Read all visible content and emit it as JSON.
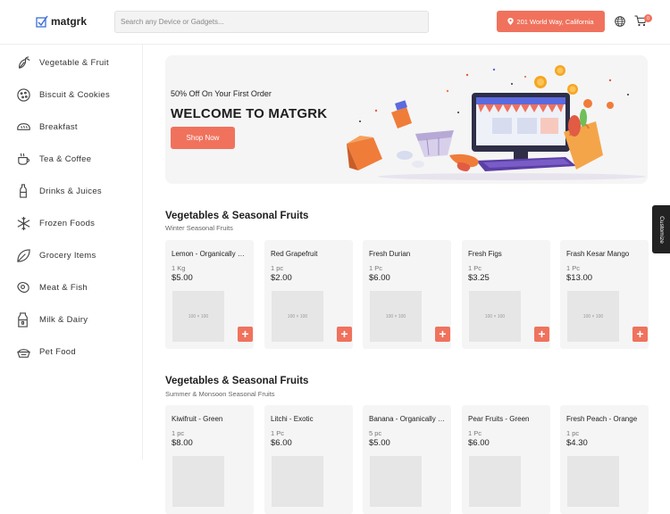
{
  "header": {
    "logo_text": "matgrk",
    "search_placeholder": "Search any Device or Gadgets...",
    "location": "201 World Way, California",
    "cart_count": "0"
  },
  "sidebar": {
    "items": [
      {
        "label": "Vegetable & Fruit",
        "icon": "vegetable-icon"
      },
      {
        "label": "Biscuit & Cookies",
        "icon": "cookie-icon"
      },
      {
        "label": "Breakfast",
        "icon": "bread-icon"
      },
      {
        "label": "Tea & Coffee",
        "icon": "cup-icon"
      },
      {
        "label": "Drinks & Juices",
        "icon": "bottle-icon"
      },
      {
        "label": "Frozen Foods",
        "icon": "snowflake-icon"
      },
      {
        "label": "Grocery Items",
        "icon": "leaf-icon"
      },
      {
        "label": "Meat & Fish",
        "icon": "meat-icon"
      },
      {
        "label": "Milk & Dairy",
        "icon": "milk-icon"
      },
      {
        "label": "Pet Food",
        "icon": "pet-food-icon"
      }
    ]
  },
  "banner": {
    "subtitle": "50% Off On Your First Order",
    "title": "WELCOME TO MATGRK",
    "button": "Shop Now"
  },
  "sections": [
    {
      "title": "Vegetables & Seasonal Fruits",
      "subtitle": "Winter Seasonal Fruits",
      "products": [
        {
          "name": "Lemon - Organically Grown",
          "unit": "1 Kg",
          "price": "$5.00"
        },
        {
          "name": "Red Grapefruit",
          "unit": "1 pc",
          "price": "$2.00"
        },
        {
          "name": "Fresh Durian",
          "unit": "1 Pc",
          "price": "$6.00"
        },
        {
          "name": "Fresh Figs",
          "unit": "1 Pc",
          "price": "$3.25"
        },
        {
          "name": "Frash Kesar Mango",
          "unit": "1 Pc",
          "price": "$13.00"
        }
      ]
    },
    {
      "title": "Vegetables & Seasonal Fruits",
      "subtitle": "Summer & Monsoon Seasonal Fruits",
      "products": [
        {
          "name": "Kiwifruit - Green",
          "unit": "1 pc",
          "price": "$8.00"
        },
        {
          "name": "Litchi - Exotic",
          "unit": "1 Pc",
          "price": "$6.00"
        },
        {
          "name": "Banana - Organically Grown",
          "unit": "5 pc",
          "price": "$5.00"
        },
        {
          "name": "Pear Fruits - Green",
          "unit": "1 Pc",
          "price": "$6.00"
        },
        {
          "name": "Fresh Peach - Orange",
          "unit": "1 pc",
          "price": "$4.30"
        }
      ]
    }
  ],
  "placeholder_image_text": "100 × 100",
  "add_button_label": "+",
  "customize_label": "Customize",
  "colors": {
    "accent": "#f0725d",
    "card_bg": "#f5f5f5",
    "banner_bg": "#f5f5f5"
  }
}
